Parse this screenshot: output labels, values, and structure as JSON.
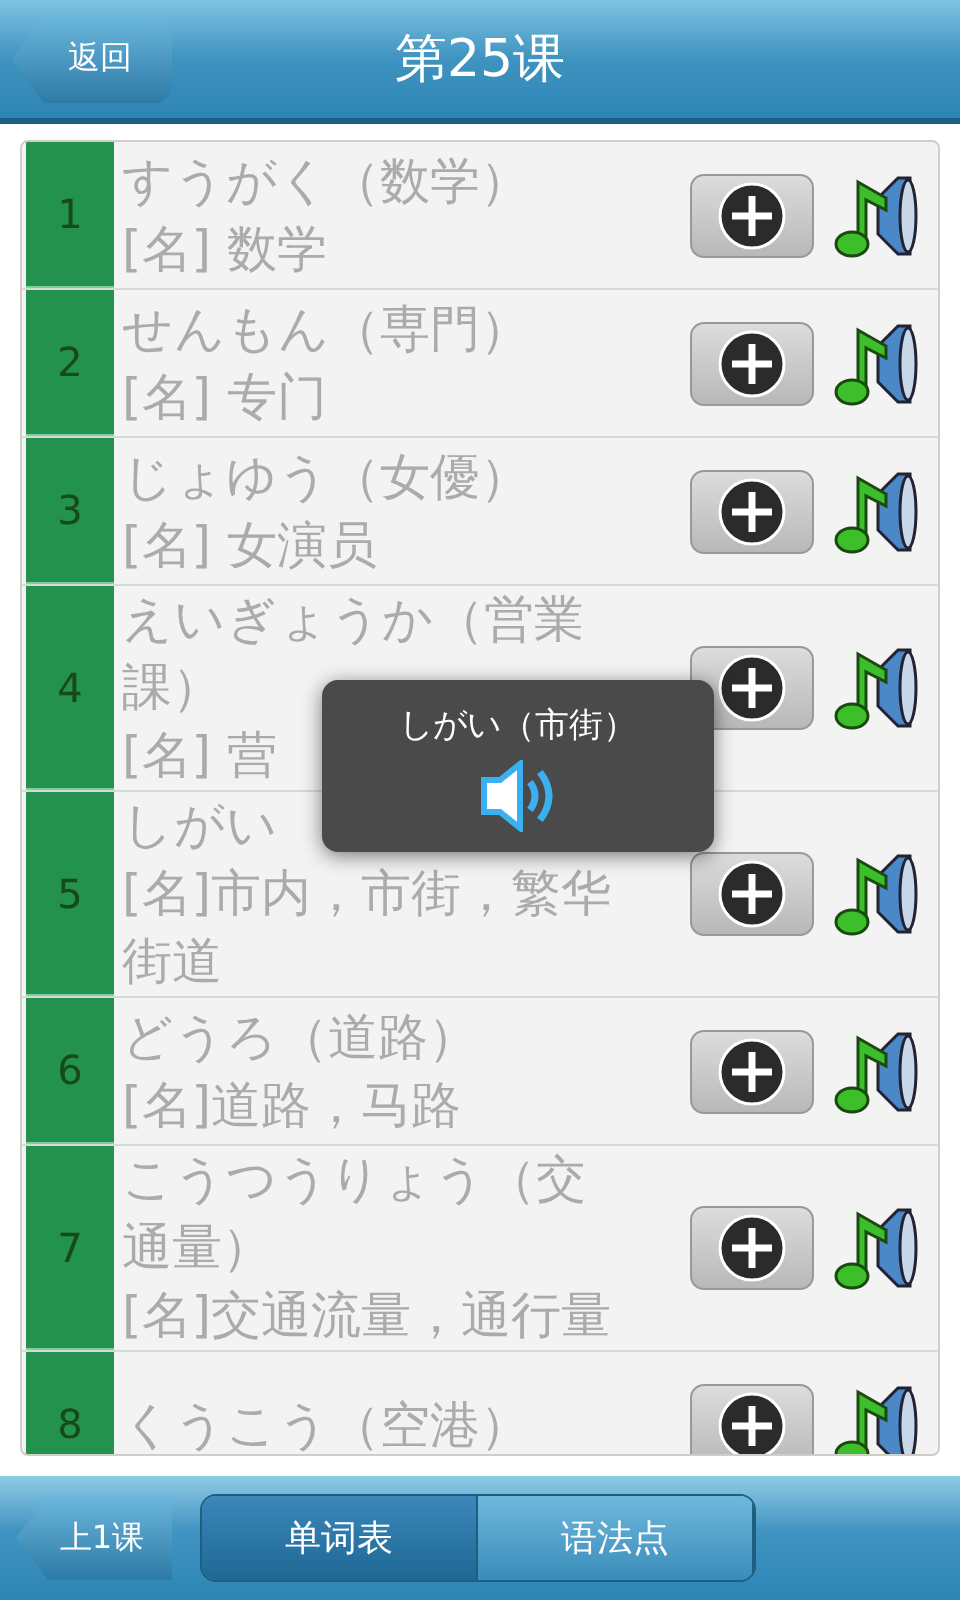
{
  "header": {
    "back_button": "返回",
    "title": "第25课"
  },
  "rows": [
    {
      "number": "1",
      "word": "すうがく（数学）",
      "meaning": "[名] 数学"
    },
    {
      "number": "2",
      "word": "せんもん（専門）",
      "meaning": "[名] 专门"
    },
    {
      "number": "3",
      "word": "じょゆう（女優）",
      "meaning": "[名] 女演员"
    },
    {
      "number": "4",
      "word": "えいぎょうか（営業課）",
      "meaning": "[名] 营"
    },
    {
      "number": "5",
      "word": "しがい",
      "meaning": "[名]市内，市街，繁华街道"
    },
    {
      "number": "6",
      "word": "どうろ（道路）",
      "meaning": "[名]道路，马路"
    },
    {
      "number": "7",
      "word": "こうつうりょう（交通量）",
      "meaning": "[名]交通流量，通行量"
    },
    {
      "number": "8",
      "word": "くうこう（空港）"
    }
  ],
  "popup": {
    "text": "しがい（市街）"
  },
  "bottom_bar": {
    "prev_button": "上1课",
    "tabs": [
      {
        "label": "单词表",
        "selected": true
      },
      {
        "label": "语法点",
        "selected": false
      }
    ]
  }
}
